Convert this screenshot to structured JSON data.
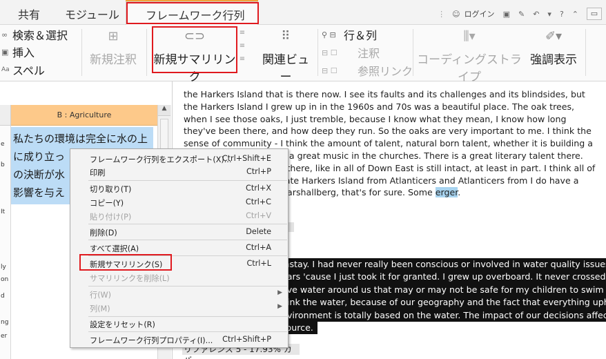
{
  "tabs": [
    {
      "label": "共有"
    },
    {
      "label": "モジュール"
    },
    {
      "label": "フレームワーク行列"
    }
  ],
  "topbar": {
    "login_label": "ログイン",
    "help_label": "?"
  },
  "ribbon": {
    "search_select": "検索＆選択",
    "insert": "挿入",
    "spell": "スペル",
    "new_memo": "新規注釈",
    "new_summary_link": "新規サマリリンク",
    "related_view": "関連ビュー",
    "rows_cols": "行＆列",
    "annotation": "注釈",
    "see_also": "参照リンク",
    "coding_stripes": "コーディングストライプ",
    "highlight": "強調表示"
  },
  "grid": {
    "column_header": "B : Agriculture",
    "cell_lines": [
      "私たちの環境は完全に水の上",
      "に成り立っ",
      "の決断が水",
      "影響を与え"
    ],
    "row_labels": [
      "e",
      "b",
      "It",
      "ly",
      "on",
      "d",
      "ng",
      "er"
    ]
  },
  "document": {
    "paragraph": "the Harkers Island that is there now. I see its faults and its challenges and its blindsides, but the Harkers Island I grew up in in the 1960s and 70s was a beautiful place. The oak trees, when I see those oaks, I just tremble, because I know what they mean, I know how long they've been there, and how deep they run. So the oaks are very important to me. I think the sense of community - I think the amount of talent, natural born talent, whether it is building a boat or singing. There's a great music in the churches. There is a great literary talent there. People there can write, there, like in all of Down East is still intact, at least in part. I think all of those actors that separate Harkers Island from Atlanticers and Atlanticers from I do have a strong influence from Marshallberg, that's for sure. Some",
    "highlighted_word": "erger",
    "period": ".",
    "black_lines": [
      "instay. I had never really been conscious or involved in water quality issues",
      "ears 'cause I just took it for granted. I grew up overboard. It never crossed",
      "ave water around us that may or may not be safe for my children to swim in",
      "hink the water, because of our geography and the fact that everything uphill",
      "nvironment is totally based on the water. The impact of our decisions affects",
      "source."
    ],
    "coverage_label": "リファレンス 5 - 17.93% カバー"
  },
  "context_menu": {
    "items": [
      {
        "label": "フレームワーク行列をエクスポート(X)...",
        "shortcut": "Ctrl+Shift+E",
        "enabled": true
      },
      {
        "label": "印刷",
        "shortcut": "Ctrl+P",
        "enabled": true
      },
      {
        "label": "切り取り(T)",
        "shortcut": "Ctrl+X",
        "enabled": true
      },
      {
        "label": "コピー(Y)",
        "shortcut": "Ctrl+C",
        "enabled": true
      },
      {
        "label": "貼り付け(P)",
        "shortcut": "Ctrl+V",
        "enabled": false
      },
      {
        "label": "削除(D)",
        "shortcut": "Delete",
        "enabled": true
      },
      {
        "label": "すべて選択(A)",
        "shortcut": "Ctrl+A",
        "enabled": true
      },
      {
        "label": "新規サマリリンク(S)",
        "shortcut": "Ctrl+L",
        "enabled": true
      },
      {
        "label": "サマリリンクを削除(L)",
        "shortcut": "",
        "enabled": false
      },
      {
        "label": "行(W)",
        "shortcut": "",
        "enabled": false
      },
      {
        "label": "列(M)",
        "shortcut": "",
        "enabled": false
      },
      {
        "label": "設定をリセット(R)",
        "shortcut": "",
        "enabled": true
      },
      {
        "label": "フレームワーク行列プロパティ(I)...",
        "shortcut": "Ctrl+Shift+P",
        "enabled": true
      }
    ]
  },
  "colors": {
    "tab_accent": "#f1a33a",
    "column_header": "#fdc98a",
    "selection": "#bcdcf6",
    "callout_red": "#e0191e"
  }
}
